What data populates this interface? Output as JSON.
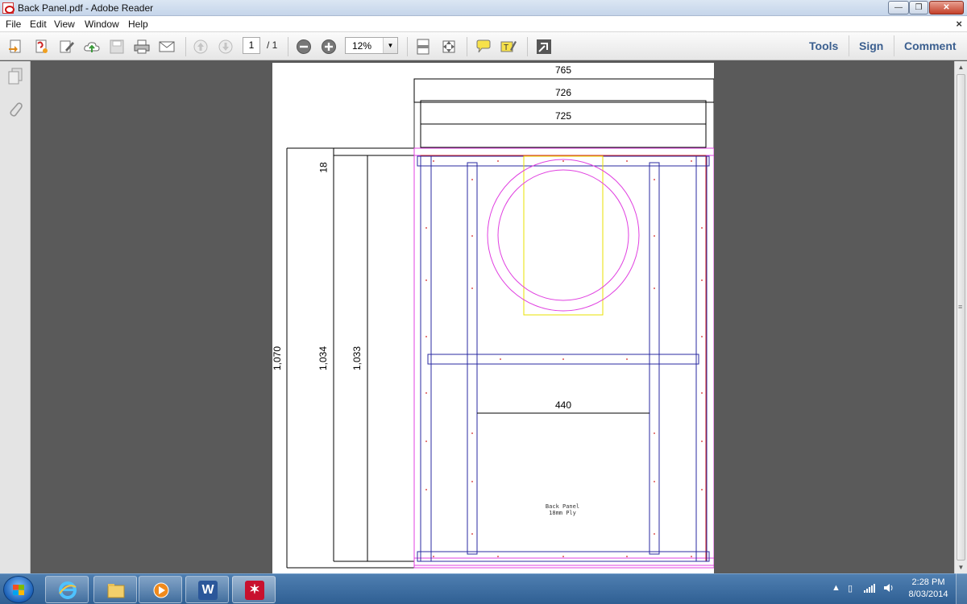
{
  "window": {
    "title": "Back Panel.pdf - Adobe Reader",
    "minimize": "—",
    "maximize": "❐",
    "close": "✕"
  },
  "menu": {
    "items": [
      "File",
      "Edit",
      "View",
      "Window",
      "Help"
    ],
    "doc_close": "×"
  },
  "toolbar": {
    "page_current": "1",
    "page_total": "/ 1",
    "zoom": "12%",
    "zoom_dropdown": "▼",
    "tools": "Tools",
    "sign": "Sign",
    "comment": "Comment"
  },
  "drawing": {
    "dim_765": "765",
    "dim_726": "726",
    "dim_725": "725",
    "dim_18": "18",
    "dim_1070": "1,070",
    "dim_1034": "1,034",
    "dim_1033": "1,033",
    "dim_440": "440",
    "note_line1": "Back Panel",
    "note_line2": "18mm Ply"
  },
  "taskbar": {
    "time": "2:28 PM",
    "date": "8/03/2014",
    "word_glyph": "W",
    "pdf_glyph": "✶"
  },
  "colors": {
    "panel_outline": "#d02020",
    "frame": "#2a2aa0",
    "cutout": "#e040e0",
    "guide": "#e8e000"
  }
}
